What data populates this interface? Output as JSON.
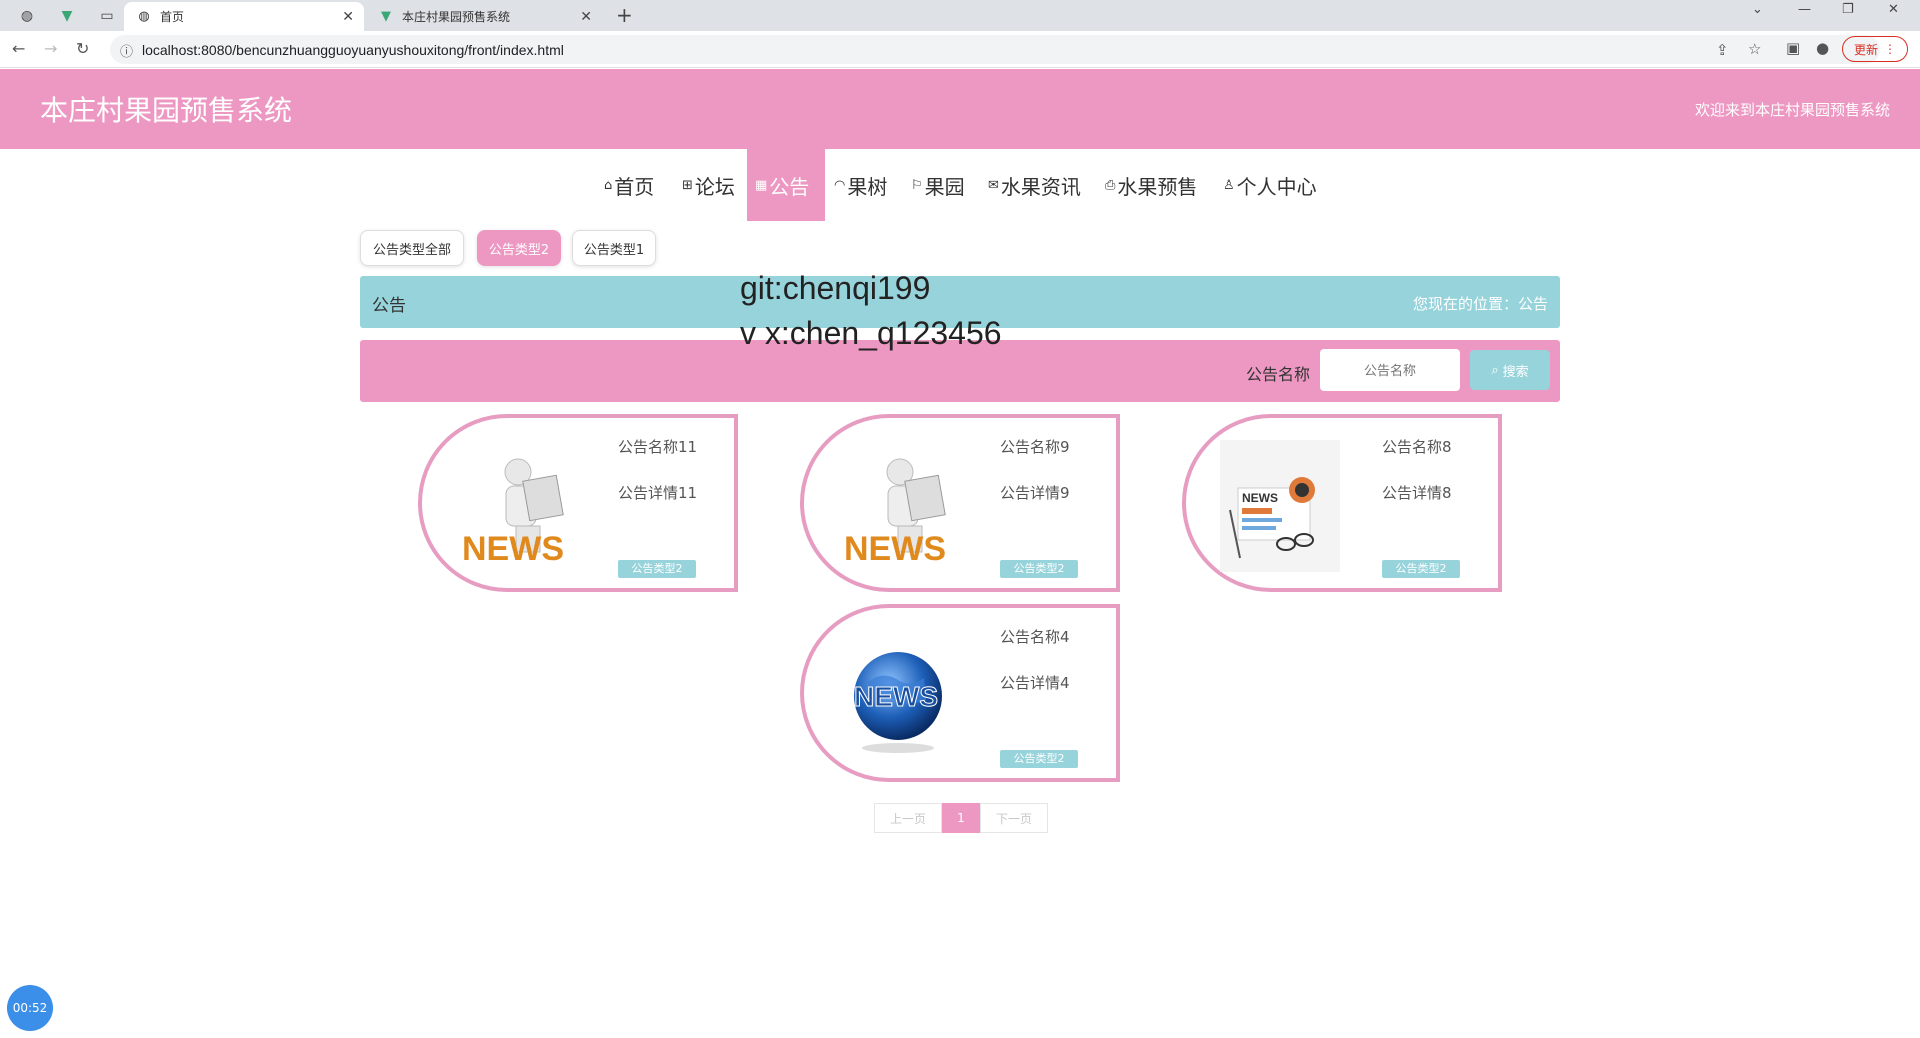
{
  "browser": {
    "tabs": [
      {
        "label": "首页",
        "active": true
      },
      {
        "label": "本庄村果园预售系统",
        "active": false
      }
    ],
    "url": "localhost:8080/bencunzhuangguoyuanyushouxitong/front/index.html",
    "update_label": "更新"
  },
  "site": {
    "title": "本庄村果园预售系统",
    "welcome": "欢迎来到本庄村果园预售系统"
  },
  "nav": {
    "items": [
      {
        "label": "首页",
        "icon": "home-icon"
      },
      {
        "label": "论坛",
        "icon": "forum-icon"
      },
      {
        "label": "公告",
        "icon": "notice-icon",
        "active": true
      },
      {
        "label": "果树",
        "icon": "tree-icon"
      },
      {
        "label": "果园",
        "icon": "flag-icon"
      },
      {
        "label": "水果资讯",
        "icon": "mail-icon"
      },
      {
        "label": "水果预售",
        "icon": "print-icon"
      },
      {
        "label": "个人中心",
        "icon": "user-icon"
      }
    ]
  },
  "filters": {
    "items": [
      {
        "label": "公告类型全部"
      },
      {
        "label": "公告类型2",
        "active": true
      },
      {
        "label": "公告类型1"
      }
    ]
  },
  "crumb": {
    "title": "公告",
    "location": "您现在的位置：公告"
  },
  "watermark": {
    "line1": "git:chenqi199",
    "line2": "v x:chen_q123456"
  },
  "search": {
    "label": "公告名称",
    "placeholder": "公告名称",
    "button": "搜索"
  },
  "cards": [
    {
      "name": "公告名称11",
      "detail": "公告详情11",
      "tag": "公告类型2",
      "image": "news-figure"
    },
    {
      "name": "公告名称9",
      "detail": "公告详情9",
      "tag": "公告类型2",
      "image": "news-figure"
    },
    {
      "name": "公告名称8",
      "detail": "公告详情8",
      "tag": "公告类型2",
      "image": "newspaper"
    },
    {
      "name": "公告名称4",
      "detail": "公告详情4",
      "tag": "公告类型2",
      "image": "news-globe"
    }
  ],
  "pager": {
    "prev": "上一页",
    "current": "1",
    "next": "下一页"
  },
  "timer": "00:52"
}
